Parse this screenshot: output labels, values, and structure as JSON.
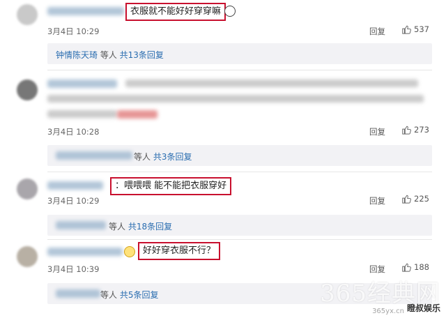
{
  "comments": [
    {
      "highlight_text": "衣服就不能好好穿穿嘛",
      "time": "3月4日 10:29",
      "reply_label": "回复",
      "likes": "537",
      "sub": {
        "name": "钟情陈天琦",
        "suffix": " 等人 ",
        "count_text": "共13条回复"
      }
    },
    {
      "time": "3月4日 10:28",
      "reply_label": "回复",
      "likes": "273",
      "sub": {
        "suffix": " 等人 ",
        "count_text": "共3条回复"
      }
    },
    {
      "highlight_text": "：喂喂喂 能不能把衣服穿好",
      "time": "3月4日 10:29",
      "reply_label": "回复",
      "likes": "225",
      "sub": {
        "suffix": "等人 ",
        "count_text": "共18条回复"
      }
    },
    {
      "highlight_text": "好好穿衣服不行？",
      "time": "3月4日 10:39",
      "reply_label": "回复",
      "likes": "188",
      "sub": {
        "suffix": " 等人 ",
        "count_text": "共5条回复"
      }
    }
  ],
  "watermark": {
    "site": "365经典网",
    "url": "365yx.cn",
    "brand": "瞪叔娱乐"
  },
  "colors": {
    "highlight_border": "#c8102e",
    "link": "#2a6db0",
    "subbox_bg": "#f2f2f5"
  },
  "icons": {
    "like": "thumbs-up-icon"
  }
}
